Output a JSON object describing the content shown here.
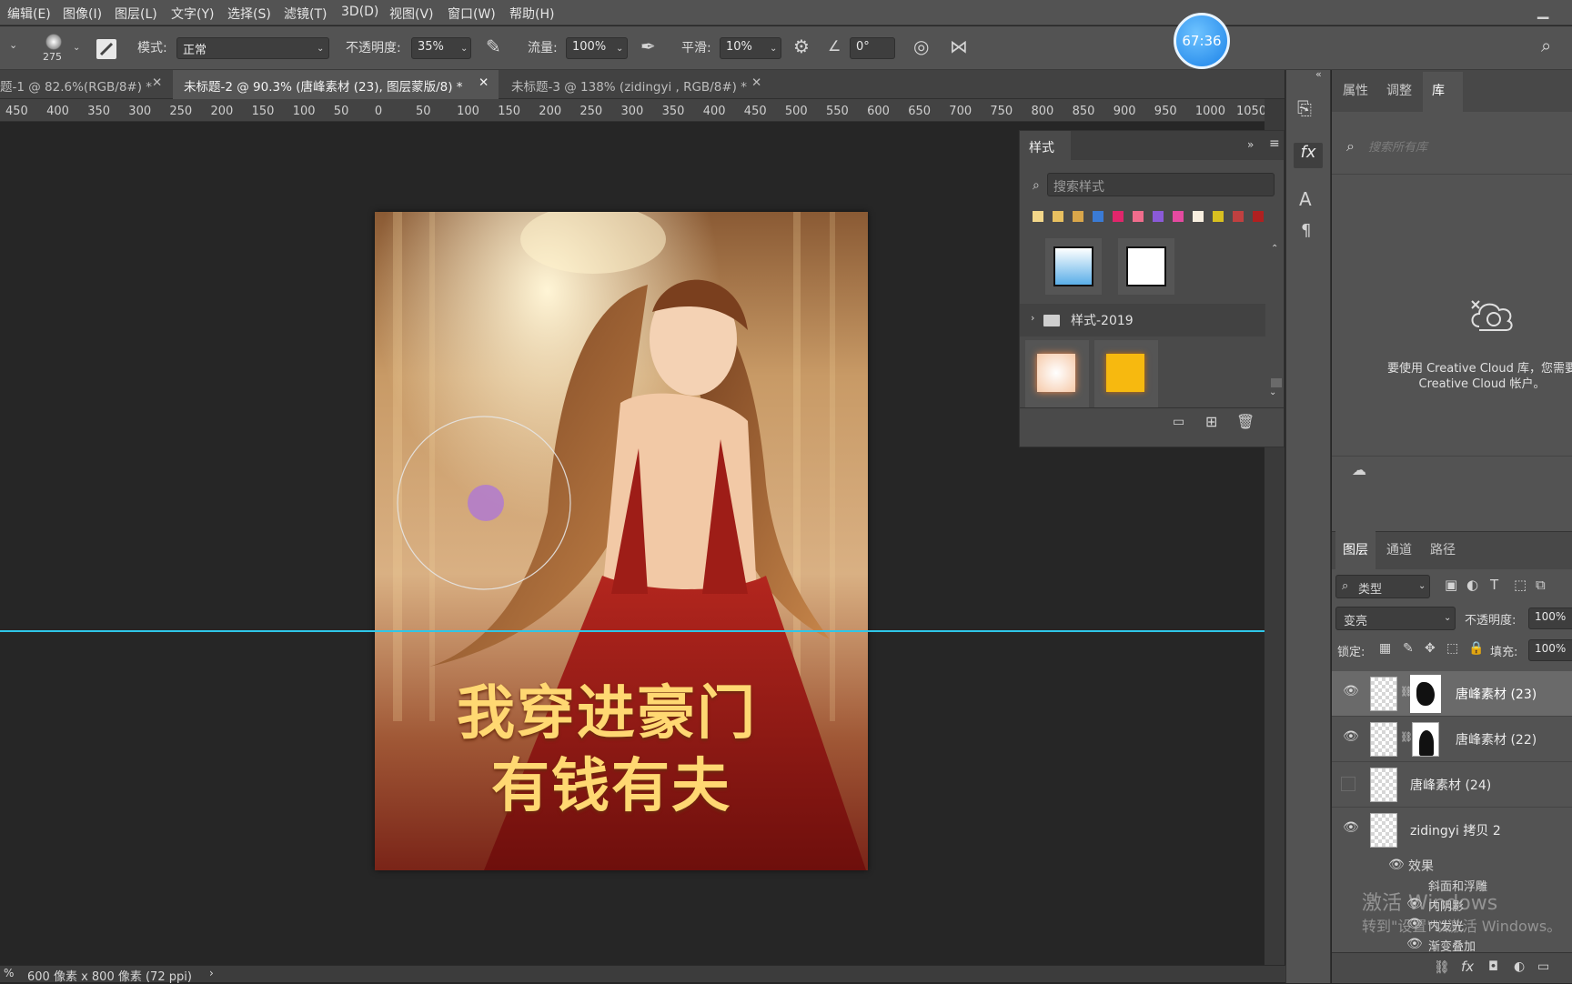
{
  "menu": [
    "编辑(E)",
    "图像(I)",
    "图层(L)",
    "文字(Y)",
    "选择(S)",
    "滤镜(T)",
    "3D(D)",
    "视图(V)",
    "窗口(W)",
    "帮助(H)"
  ],
  "options": {
    "brush_size": "275",
    "mode_label": "模式:",
    "mode_value": "正常",
    "opacity_label": "不透明度:",
    "opacity_value": "35%",
    "flow_label": "流量:",
    "flow_value": "100%",
    "smooth_label": "平滑:",
    "smooth_value": "10%",
    "angle_value": "0°"
  },
  "timer": "67:36",
  "tabs": [
    {
      "label": "题-1 @ 82.6%(RGB/8#) *",
      "active": false
    },
    {
      "label": "未标题-2 @ 90.3% (唐峰素材 (23), 图层蒙版/8) *",
      "active": true
    },
    {
      "label": "未标题-3 @ 138% (zidingyi , RGB/8#) *",
      "active": false
    }
  ],
  "ruler_ticks": [
    "450",
    "400",
    "350",
    "300",
    "250",
    "200",
    "150",
    "100",
    "50",
    "0",
    "50",
    "100",
    "150",
    "200",
    "250",
    "300",
    "350",
    "400",
    "450",
    "500",
    "550",
    "600",
    "650",
    "700",
    "750",
    "800",
    "850",
    "900",
    "950",
    "1000",
    "1050"
  ],
  "styles_panel": {
    "title": "样式",
    "search_placeholder": "搜索样式",
    "folder_label": "样式-2019"
  },
  "artwork": {
    "title_line1": "我穿进豪门",
    "title_line2": "有钱有夫"
  },
  "right_panel": {
    "tabs": [
      "属性",
      "调整",
      "库"
    ],
    "active_tab": "库",
    "search_placeholder": "搜索所有库",
    "cc_message_line1": "要使用 Creative Cloud 库，您需要",
    "cc_message_line2": "Creative Cloud 帐户。"
  },
  "layers_panel": {
    "tabs": [
      "图层",
      "通道",
      "路径"
    ],
    "filter_label": "类型",
    "blend_mode": "变亮",
    "opacity_label": "不透明度:",
    "opacity_value": "100%",
    "lock_label": "锁定:",
    "fill_label": "填充:",
    "fill_value": "100%",
    "layers": [
      {
        "name": "唐峰素材 (23)",
        "visible": true,
        "selected": true,
        "mask": true
      },
      {
        "name": "唐峰素材 (22)",
        "visible": true,
        "selected": false,
        "mask": true
      },
      {
        "name": "唐峰素材 (24)",
        "visible": false,
        "selected": false,
        "mask": false
      },
      {
        "name": "zidingyi  拷贝 2",
        "visible": true,
        "selected": false,
        "mask": false
      }
    ],
    "effects_label": "效果",
    "effects": [
      "斜面和浮雕",
      "内阴影",
      "内发光",
      "渐变叠加"
    ]
  },
  "status": {
    "doc_info": "600 像素 x 800 像素 (72 ppi)"
  },
  "watermark": {
    "line1": "激活 Windows",
    "line2": "转到\"设置\"以激活 Windows。"
  }
}
